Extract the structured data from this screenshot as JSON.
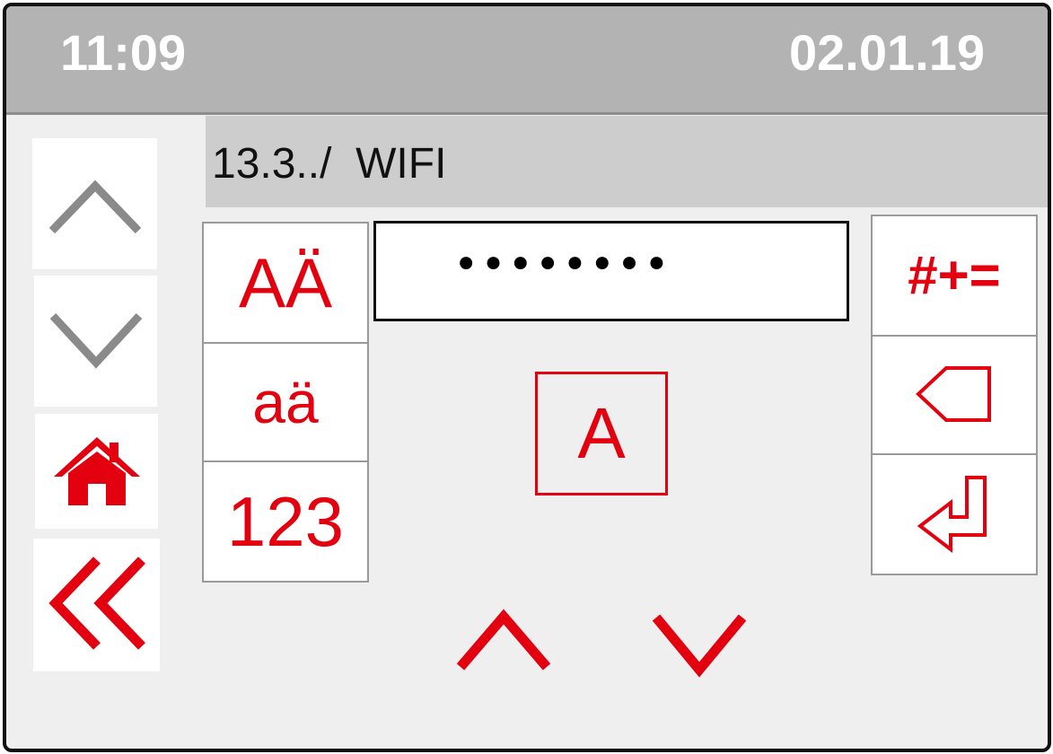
{
  "status": {
    "time": "11:09",
    "date": "02.01.19"
  },
  "nav": {
    "up_icon": "chevron-up-icon",
    "down_icon": "chevron-down-icon",
    "home_icon": "home-icon",
    "back_icon": "double-chevron-left-icon"
  },
  "header": {
    "title": "13.3../  WIFI"
  },
  "keyboard": {
    "modes": [
      "AÄ",
      "aä",
      "123"
    ],
    "symbols_label": "#+=",
    "backspace_icon": "backspace-icon",
    "enter_icon": "enter-icon"
  },
  "password": {
    "masked_value": "••••••••"
  },
  "selector": {
    "current_char": "A",
    "up_icon": "chevron-up-icon",
    "down_icon": "chevron-down-icon"
  },
  "colors": {
    "accent": "#e3000f",
    "gray_arrow": "#8a8a8a",
    "statusbar": "#b3b3b3",
    "background": "#efefef"
  }
}
